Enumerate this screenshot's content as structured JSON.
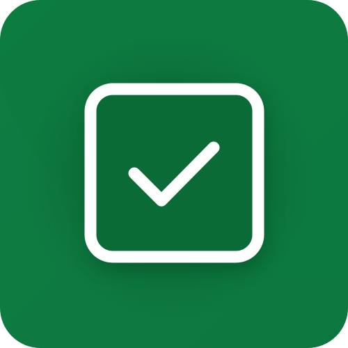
{
  "icon": {
    "name": "checkbox-checked-app-icon",
    "glyph": "check-icon",
    "colors": {
      "background_light": "#0f7e42",
      "background_dark": "#0a6a35",
      "shadow": "#064a25",
      "stroke": "#ffffff",
      "inner_fill": "#0b6e39"
    }
  }
}
